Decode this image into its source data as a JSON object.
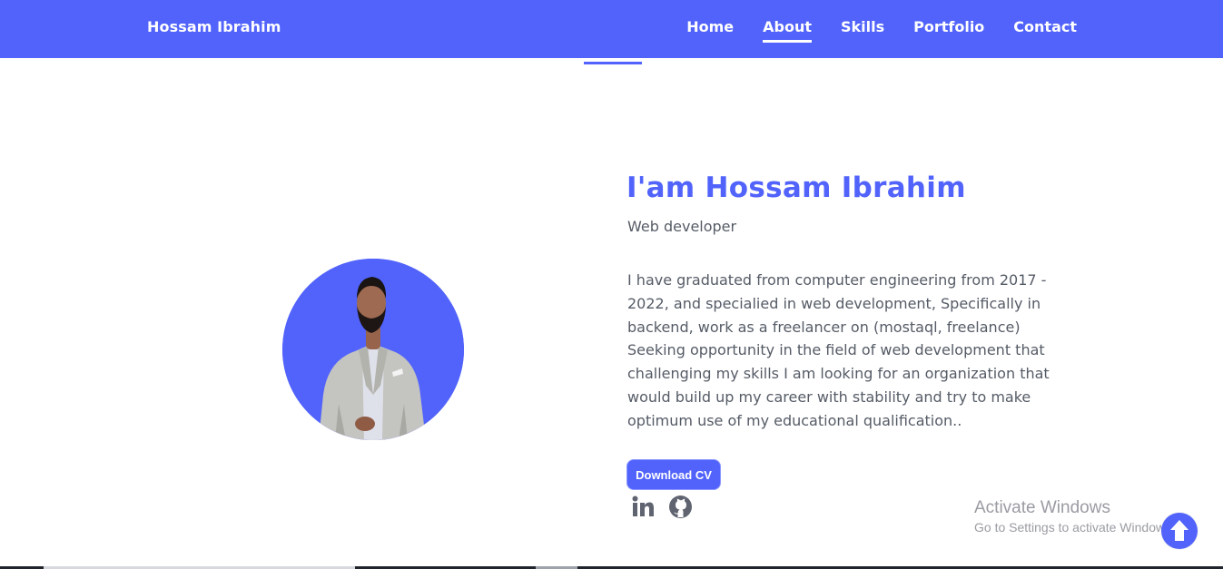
{
  "navbar": {
    "brand": "Hossam Ibrahim",
    "links": [
      {
        "label": "Home",
        "active": false
      },
      {
        "label": "About",
        "active": true
      },
      {
        "label": "Skills",
        "active": false
      },
      {
        "label": "Portfolio",
        "active": false
      },
      {
        "label": "Contact",
        "active": false
      }
    ]
  },
  "about": {
    "headline": "I'am Hossam Ibrahim",
    "subtitle": "Web developer",
    "bio": "I have graduated from computer engineering from 2017 - 2022, and specialied in web development, Specifically in backend, work as a freelancer on (mostaql, freelance) Seeking opportunity in the field of web development that challenging my skills I am looking for an organization that would build up my career with stability and try to make optimum use of my educational qualification..",
    "download_button": "Download CV",
    "social_icons": [
      "linkedin-icon",
      "github-icon"
    ]
  },
  "watermark": {
    "title": "Activate Windows",
    "subtitle": "Go to Settings to activate Windows."
  },
  "colors": {
    "accent": "#5163fb",
    "text_muted": "#555b66",
    "watermark": "#9a9ca3"
  },
  "icons": {
    "scroll_top": "arrow-up-icon"
  }
}
